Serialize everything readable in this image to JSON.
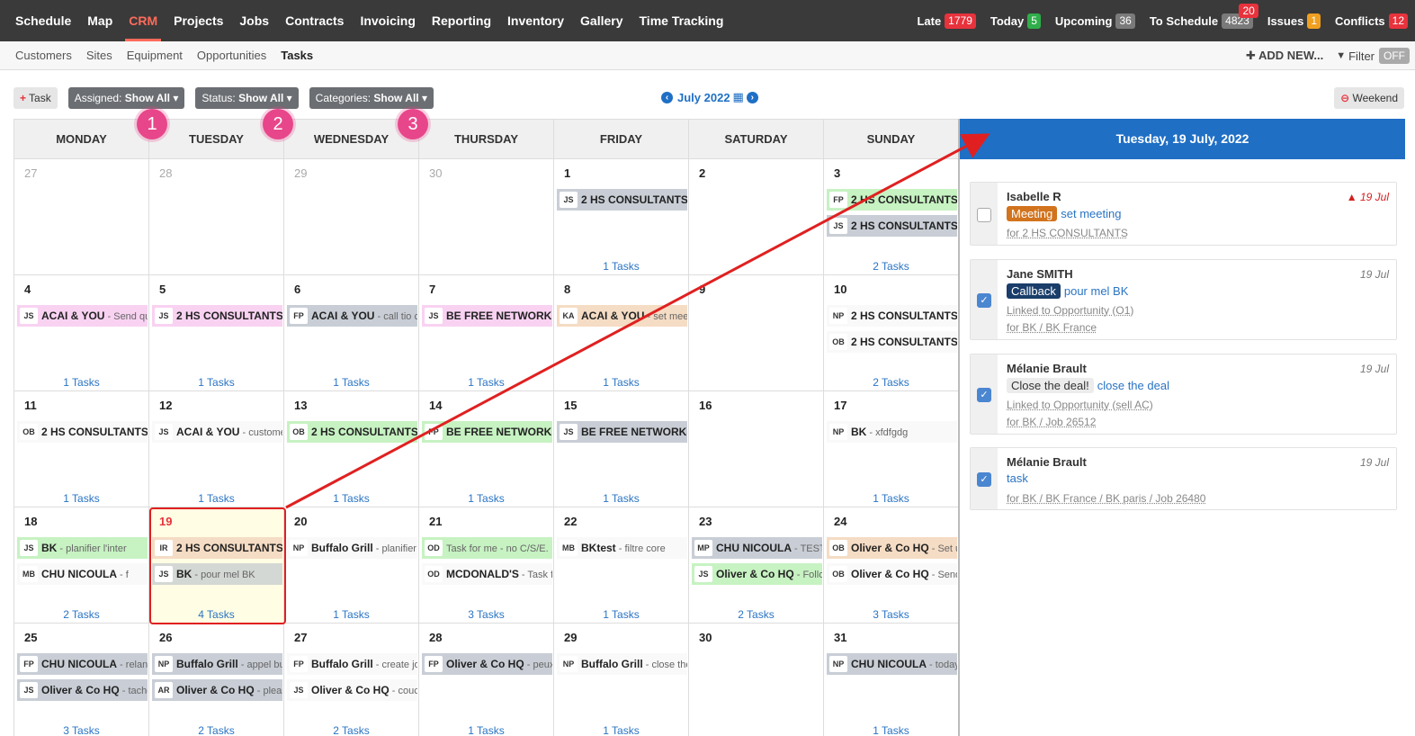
{
  "topnav": {
    "items": [
      "Schedule",
      "Map",
      "CRM",
      "Projects",
      "Jobs",
      "Contracts",
      "Invoicing",
      "Reporting",
      "Inventory",
      "Gallery",
      "Time Tracking"
    ],
    "active_index": 2,
    "counters": [
      {
        "label": "Late",
        "value": "1779",
        "color": "red"
      },
      {
        "label": "Today",
        "value": "5",
        "color": "green"
      },
      {
        "label": "Upcoming",
        "value": "36",
        "color": "gray"
      },
      {
        "label": "To Schedule",
        "value": "4823",
        "color": "gray",
        "extra": "20"
      },
      {
        "label": "Issues",
        "value": "1",
        "color": "orange"
      },
      {
        "label": "Conflicts",
        "value": "12",
        "color": "red"
      }
    ]
  },
  "subnav": {
    "tabs": [
      "Customers",
      "Sites",
      "Equipment",
      "Opportunities",
      "Tasks"
    ],
    "active_index": 4,
    "add_new": "ADD NEW...",
    "filter": "Filter",
    "filter_state": "OFF"
  },
  "toolbar": {
    "task_button": "Task",
    "assigned_label": "Assigned:",
    "assigned_value": "Show All",
    "status_label": "Status:",
    "status_value": "Show All",
    "categories_label": "Categories:",
    "categories_value": "Show All",
    "month": "July 2022",
    "weekend": "Weekend"
  },
  "annotations": [
    "1",
    "2",
    "3"
  ],
  "calendar": {
    "weekdays": [
      "MONDAY",
      "TUESDAY",
      "WEDNESDAY",
      "THURSDAY",
      "FRIDAY",
      "SATURDAY",
      "SUNDAY"
    ],
    "weeks": [
      [
        {
          "day": "27",
          "muted": true,
          "tasks": [],
          "count": ""
        },
        {
          "day": "28",
          "muted": true,
          "tasks": [],
          "count": ""
        },
        {
          "day": "29",
          "muted": true,
          "tasks": [],
          "count": ""
        },
        {
          "day": "30",
          "muted": true,
          "tasks": [],
          "count": ""
        },
        {
          "day": "1",
          "tasks": [
            {
              "ini": "JS",
              "cust": "2 HS CONSULTANTS",
              "desc": " -",
              "color": "gray"
            }
          ],
          "count": "1 Tasks"
        },
        {
          "day": "2",
          "tasks": [],
          "count": ""
        },
        {
          "day": "3",
          "tasks": [
            {
              "ini": "FP",
              "cust": "2 HS CONSULTANTS",
              "desc": " -",
              "color": "green"
            },
            {
              "ini": "JS",
              "cust": "2 HS CONSULTANTS",
              "desc": " -",
              "color": "gray"
            }
          ],
          "count": "2 Tasks"
        }
      ],
      [
        {
          "day": "4",
          "tasks": [
            {
              "ini": "JS",
              "cust": "ACAI & YOU",
              "desc": " - Send qu",
              "color": "pink"
            }
          ],
          "count": "1 Tasks"
        },
        {
          "day": "5",
          "tasks": [
            {
              "ini": "JS",
              "cust": "2 HS CONSULTANTS",
              "desc": "",
              "color": "pink"
            }
          ],
          "count": "1 Tasks"
        },
        {
          "day": "6",
          "tasks": [
            {
              "ini": "FP",
              "cust": "ACAI & YOU",
              "desc": " - call tio c",
              "color": "gray"
            }
          ],
          "count": "1 Tasks"
        },
        {
          "day": "7",
          "tasks": [
            {
              "ini": "JS",
              "cust": "BE FREE NETWORKS",
              "desc": " -",
              "color": "pink"
            }
          ],
          "count": "1 Tasks"
        },
        {
          "day": "8",
          "tasks": [
            {
              "ini": "KA",
              "cust": "ACAI & YOU",
              "desc": " - set meet",
              "color": "peach"
            }
          ],
          "count": "1 Tasks"
        },
        {
          "day": "9",
          "tasks": [],
          "count": ""
        },
        {
          "day": "10",
          "tasks": [
            {
              "ini": "NP",
              "cust": "2 HS CONSULTANTS",
              "desc": " -",
              "color": "none"
            },
            {
              "ini": "OB",
              "cust": "2 HS CONSULTANTS",
              "desc": " -",
              "color": "none"
            }
          ],
          "count": "2 Tasks"
        }
      ],
      [
        {
          "day": "11",
          "tasks": [
            {
              "ini": "OB",
              "cust": "2 HS CONSULTANTS",
              "desc": "",
              "color": "none"
            }
          ],
          "count": "1 Tasks"
        },
        {
          "day": "12",
          "tasks": [
            {
              "ini": "JS",
              "cust": "ACAI & YOU",
              "desc": " - custome",
              "color": "none"
            }
          ],
          "count": "1 Tasks"
        },
        {
          "day": "13",
          "tasks": [
            {
              "ini": "OB",
              "cust": "2 HS CONSULTANTS",
              "desc": "",
              "color": "green"
            }
          ],
          "count": "1 Tasks"
        },
        {
          "day": "14",
          "tasks": [
            {
              "ini": "FP",
              "cust": "BE FREE NETWORKS",
              "desc": " -",
              "color": "green"
            }
          ],
          "count": "1 Tasks"
        },
        {
          "day": "15",
          "tasks": [
            {
              "ini": "JS",
              "cust": "BE FREE NETWORKS",
              "desc": " -",
              "color": "gray"
            }
          ],
          "count": "1 Tasks"
        },
        {
          "day": "16",
          "tasks": [],
          "count": ""
        },
        {
          "day": "17",
          "tasks": [
            {
              "ini": "NP",
              "cust": "BK",
              "desc": " - xfdfgdg",
              "color": "none"
            }
          ],
          "count": "1 Tasks"
        }
      ],
      [
        {
          "day": "18",
          "tasks": [
            {
              "ini": "JS",
              "cust": "BK",
              "desc": " - planifier l'inter",
              "color": "green"
            },
            {
              "ini": "MB",
              "cust": "CHU NICOULA",
              "desc": " - f",
              "color": "none"
            }
          ],
          "count": "2 Tasks"
        },
        {
          "day": "19",
          "today": true,
          "tasks": [
            {
              "ini": "IR",
              "cust": "2 HS CONSULTANTS",
              "desc": " -",
              "color": "peach"
            },
            {
              "ini": "JS",
              "cust": "BK",
              "desc": " - pour mel BK",
              "color": "gray2"
            }
          ],
          "count": "4 Tasks"
        },
        {
          "day": "20",
          "tasks": [
            {
              "ini": "NP",
              "cust": "Buffalo Grill",
              "desc": " - planifier",
              "color": "none"
            }
          ],
          "count": "1 Tasks"
        },
        {
          "day": "21",
          "tasks": [
            {
              "ini": "OD",
              "cust": "",
              "desc": "Task for me - no C/S/E.",
              "color": "green"
            },
            {
              "ini": "OD",
              "cust": "MCDONALD'S",
              "desc": " - Task f",
              "color": "none"
            }
          ],
          "count": "3 Tasks"
        },
        {
          "day": "22",
          "tasks": [
            {
              "ini": "MB",
              "cust": "BKtest",
              "desc": " - filtre core",
              "color": "none"
            }
          ],
          "count": "1 Tasks"
        },
        {
          "day": "23",
          "tasks": [
            {
              "ini": "MP",
              "cust": "CHU NICOULA",
              "desc": " - TEST",
              "color": "gray"
            },
            {
              "ini": "JS",
              "cust": "Oliver & Co HQ",
              "desc": " - Follo",
              "color": "green"
            }
          ],
          "count": "2 Tasks"
        },
        {
          "day": "24",
          "tasks": [
            {
              "ini": "OB",
              "cust": "Oliver & Co HQ",
              "desc": " - Set u",
              "color": "peach"
            },
            {
              "ini": "OB",
              "cust": "Oliver & Co HQ",
              "desc": " - Send",
              "color": "none"
            }
          ],
          "count": "3 Tasks"
        }
      ],
      [
        {
          "day": "25",
          "tasks": [
            {
              "ini": "FP",
              "cust": "CHU NICOULA",
              "desc": " - relanc",
              "color": "gray"
            },
            {
              "ini": "JS",
              "cust": "Oliver & Co HQ",
              "desc": " - tache",
              "color": "gray"
            }
          ],
          "count": "3 Tasks"
        },
        {
          "day": "26",
          "tasks": [
            {
              "ini": "NP",
              "cust": "Buffalo Grill",
              "desc": " - appel bu",
              "color": "gray"
            },
            {
              "ini": "AR",
              "cust": "Oliver & Co HQ",
              "desc": " - pleas",
              "color": "gray"
            }
          ],
          "count": "2 Tasks"
        },
        {
          "day": "27",
          "tasks": [
            {
              "ini": "FP",
              "cust": "Buffalo Grill",
              "desc": " - create jo",
              "color": "none"
            },
            {
              "ini": "JS",
              "cust": "Oliver & Co HQ",
              "desc": " - couc",
              "color": "none"
            }
          ],
          "count": "2 Tasks"
        },
        {
          "day": "28",
          "tasks": [
            {
              "ini": "FP",
              "cust": "Oliver & Co HQ",
              "desc": " - peux-",
              "color": "gray"
            }
          ],
          "count": "1 Tasks"
        },
        {
          "day": "29",
          "tasks": [
            {
              "ini": "NP",
              "cust": "Buffalo Grill",
              "desc": " - close the",
              "color": "none"
            }
          ],
          "count": "1 Tasks"
        },
        {
          "day": "30",
          "tasks": [],
          "count": ""
        },
        {
          "day": "31",
          "tasks": [
            {
              "ini": "NP",
              "cust": "CHU NICOULA",
              "desc": " - today",
              "color": "gray"
            }
          ],
          "count": "1 Tasks"
        }
      ]
    ]
  },
  "panel": {
    "title": "Tuesday, 19 July, 2022",
    "cards": [
      {
        "name": "Isabelle R",
        "date": "19 Jul",
        "due": true,
        "checked": false,
        "category": "Meeting",
        "cat_color": "orange",
        "title": "set meeting",
        "lines": [
          "for 2 HS CONSULTANTS"
        ]
      },
      {
        "name": "Jane SMITH",
        "date": "19 Jul",
        "due": false,
        "checked": true,
        "category": "Callback",
        "cat_color": "navy",
        "title": "pour mel BK",
        "lines": [
          "Linked to Opportunity (O1)",
          "for BK / BK France"
        ]
      },
      {
        "name": "Mélanie Brault",
        "date": "19 Jul",
        "due": false,
        "checked": true,
        "category": "Close the deal!",
        "cat_color": "light",
        "title": "close the deal",
        "lines": [
          "Linked to Opportunity (sell AC)",
          "for BK / Job 26512"
        ]
      },
      {
        "name": "Mélanie Brault",
        "date": "19 Jul",
        "due": false,
        "checked": true,
        "category": "",
        "cat_color": "",
        "title": "task",
        "lines": [
          "for BK / BK France / BK paris / Job 26480"
        ]
      }
    ]
  },
  "colors": {
    "nav_bg": "#3a3a3a",
    "accent": "#ff6b5b",
    "panel_header": "#1f6fc5",
    "highlight": "#e02020",
    "annotation": "#e8468a"
  }
}
